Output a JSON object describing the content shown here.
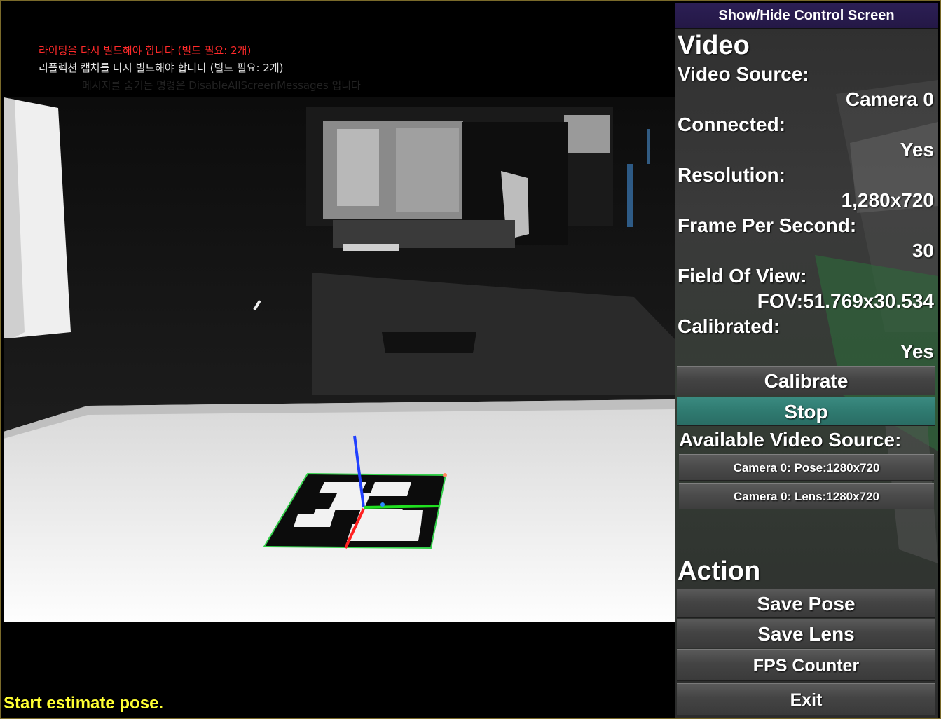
{
  "screen_messages": [
    {
      "text": "라이팅을 다시 빌드해야 합니다 (빌드 필요: 2개)",
      "color": "#ff2a2a"
    },
    {
      "text": "리플렉션 캡처를 다시 빌드해야 합니다 (빌드 필요: 2개)",
      "color": "#e6e6e6"
    },
    {
      "text": "메시지를 숨기는 명령은 DisableAllScreenMessages 입니다",
      "color": "#222222"
    }
  ],
  "status": {
    "text": "Start estimate pose.",
    "color": "#ffff33"
  },
  "panel": {
    "toggle_label": "Show/Hide Control Screen",
    "video": {
      "heading": "Video",
      "fields": [
        {
          "label": "Video Source:",
          "value": "Camera 0"
        },
        {
          "label": "Connected:",
          "value": "Yes"
        },
        {
          "label": "Resolution:",
          "value": "1,280x720"
        },
        {
          "label": "Frame Per Second:",
          "value": "30"
        },
        {
          "label": "Field Of View:",
          "value": "FOV:51.769x30.534"
        },
        {
          "label": "Calibrated:",
          "value": "Yes"
        }
      ],
      "calibrate_label": "Calibrate",
      "stop_label": "Stop",
      "available_label": "Available Video Source:",
      "sources": [
        "Camera 0: Pose:1280x720",
        "Camera 0: Lens:1280x720"
      ]
    },
    "action": {
      "heading": "Action",
      "buttons": [
        "Save Pose",
        "Save Lens",
        "FPS Counter",
        "Exit"
      ]
    }
  },
  "axis_colors": {
    "x": "#ff2020",
    "y": "#20e020",
    "z": "#2040ff"
  }
}
